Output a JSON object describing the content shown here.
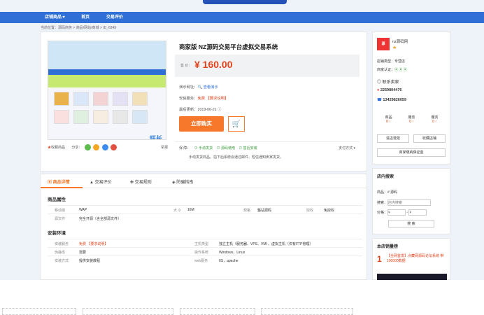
{
  "nav": {
    "items": [
      "店铺商品 ▾",
      "首页",
      "交易评价"
    ]
  },
  "breadcrumb": "当前位置：源码商务 > 商品/网站/商城 > ID_6249",
  "product": {
    "title": "商家版 NZ源码交易平台虚拟交易系统",
    "price_label": "售 价：",
    "price": "¥ 160.00",
    "rows": [
      {
        "label": "演示网址：",
        "value": "🔍 查看演示"
      },
      {
        "label": "安装服务：",
        "value": "免费 【要求说明】"
      },
      {
        "label": "最后更新：",
        "value": "2019-06-21 ⓘ"
      }
    ],
    "buy": "立即购买",
    "cart": "🛒",
    "fav": "收藏商品",
    "share": "分享：",
    "report": "举报",
    "guarantee_label": "保 障：",
    "guarantees": [
      "⊙ 手动发货",
      "⊙ 源码使用",
      "⊙ 售后安装"
    ],
    "pay": "支付方式 ▾",
    "notice": "手动发货商品，拍下后系统会通过邮件、短信通知卖家发货。",
    "brand": "旺长网"
  },
  "seller": {
    "name": "nz源码网",
    "type": "店铺类型：专营店",
    "verify": "商家认证：",
    "contact": "联系卖家",
    "qq": "2259804476",
    "phone": "13429826059",
    "stats": [
      {
        "label": "商品",
        "value": "0 ↑"
      },
      {
        "label": "服务",
        "value": "0 ↑"
      },
      {
        "label": "服务",
        "value": "0 ↑"
      }
    ],
    "btn_enter": "进店逛逛",
    "btn_fav": "收藏店铺",
    "deposit": "商家缴纳保证金"
  },
  "search": {
    "title": "店内搜索",
    "kw_label": "商品：",
    "kw_value": "# 源码",
    "kw2_label": "搜索：",
    "kw2_value": "店内搜索",
    "price_label": "价格：",
    "from": "¥",
    "to": "¥",
    "btn": "搜 索"
  },
  "recommend": {
    "title": "本店销量榜",
    "rank": "1",
    "text": "【全网首发】点藏网源码论坛系统 带100000数据"
  },
  "detail": {
    "tabs": [
      "商品详情",
      "交易评价",
      "交易规则",
      "防骗指南"
    ],
    "attr_title": "商品属性",
    "attrs": [
      [
        {
          "l": "移动端",
          "v": "WAP"
        },
        {
          "l": "大 小",
          "v": "16M"
        },
        {
          "l": "规格",
          "v": "整站源码"
        },
        {
          "l": "授权",
          "v": "免授权"
        }
      ],
      [
        {
          "l": "源文件",
          "v": "完全开源（含全部源文件）"
        }
      ]
    ],
    "env_title": "安装环境",
    "env": [
      [
        {
          "l": "安装服务",
          "v": "免费 【要求说明】"
        },
        {
          "l": "主机类型",
          "v": "独立主机（服务器、VPS、VM）、虚拟主机（仅有FTP管理）"
        }
      ],
      [
        {
          "l": "伪静态",
          "v": "需要"
        },
        {
          "l": "操作系统",
          "v": "Windows，Linux"
        }
      ],
      [
        {
          "l": "安装方式",
          "v": "提供安装教程"
        },
        {
          "l": "web服务",
          "v": "IIS，apache"
        }
      ]
    ]
  },
  "colors": {
    "nav": "#2f6fd6",
    "accent": "#f7772b",
    "price": "#e1421a"
  }
}
